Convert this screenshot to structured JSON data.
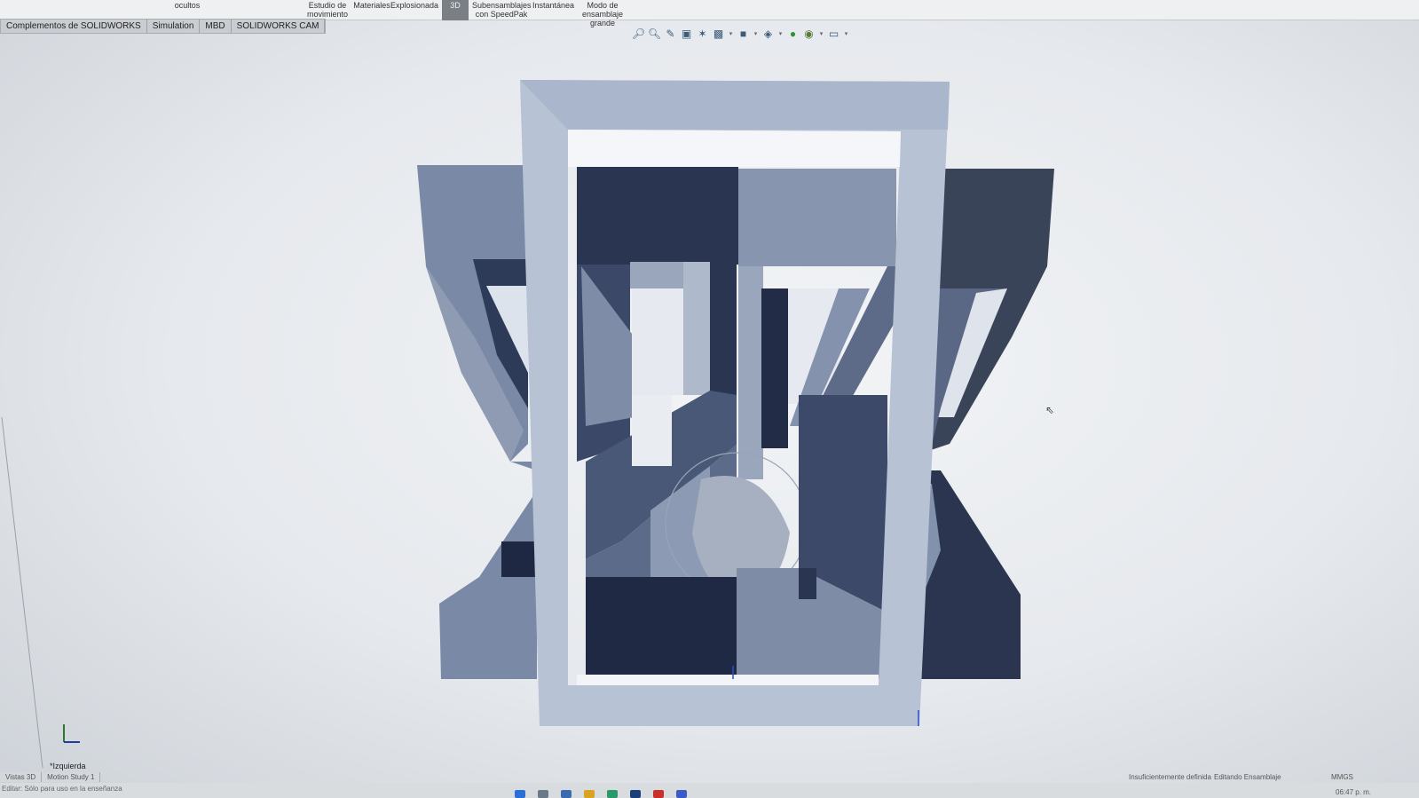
{
  "ribbon": {
    "items": [
      {
        "label": "ocultos"
      },
      {
        "label": "Estudio de\nmovimiento"
      },
      {
        "label": "Materiales"
      },
      {
        "label": "Explosionada"
      },
      {
        "label": "3D"
      },
      {
        "label": "Subensamblajes\ncon SpeedPak"
      },
      {
        "label": "Instantánea"
      },
      {
        "label": "Modo de ensamblaje\ngrande"
      }
    ]
  },
  "tabs": [
    {
      "label": "Complementos de SOLIDWORKS"
    },
    {
      "label": "Simulation"
    },
    {
      "label": "MBD"
    },
    {
      "label": "SOLIDWORKS CAM"
    }
  ],
  "hud": {
    "icons": [
      "zoom-to-fit-icon",
      "zoom-to-area-icon",
      "previous-view-icon",
      "section-view-icon",
      "dynamic-annotation-icon",
      "view-orientation-icon",
      "display-style-icon",
      "hide-show-items-icon",
      "edit-appearance-icon",
      "apply-scene-icon",
      "view-settings-icon"
    ]
  },
  "viewport": {
    "view_name": "*Izquierda"
  },
  "bottom_tabs": [
    {
      "label": "Vistas 3D"
    },
    {
      "label": "Motion Study 1"
    }
  ],
  "status": {
    "left": "Editar: Sólo para uso en la enseñanza",
    "definition": "Insuficientemente definida",
    "editing": "Editando Ensamblaje",
    "units": "MMGS",
    "time": "06:47 p. m."
  },
  "colors": {
    "dark_navy": "#2a3550",
    "mid_slate": "#4a5878",
    "light_slate": "#8a97b0",
    "pale_slate": "#aab5c9",
    "frame": "#b8c3d6"
  }
}
